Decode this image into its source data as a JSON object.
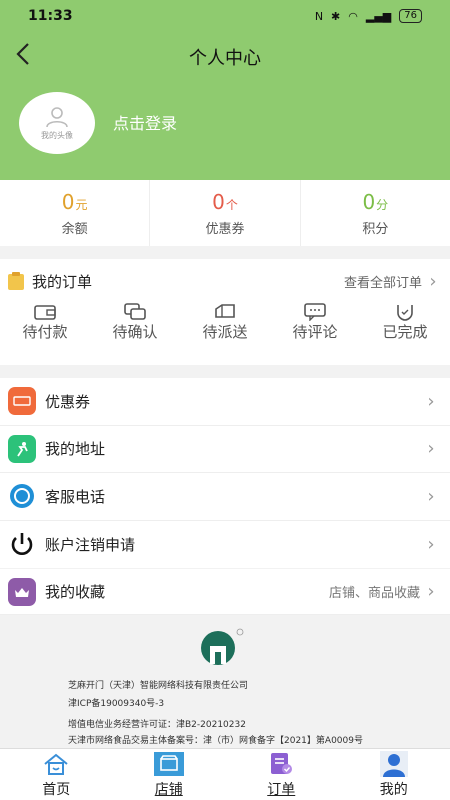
{
  "status_bar": {
    "time": "11:33",
    "battery": "76"
  },
  "header": {
    "title": "个人中心",
    "avatar_caption": "我的头像",
    "login_label": "点击登录"
  },
  "stats": [
    {
      "value": "0",
      "unit": "元",
      "label": "余额"
    },
    {
      "value": "0",
      "unit": "个",
      "label": "优惠券"
    },
    {
      "value": "0",
      "unit": "分",
      "label": "积分"
    }
  ],
  "orders": {
    "title": "我的订单",
    "view_all": "查看全部订单",
    "steps": [
      "待付款",
      "待确认",
      "待派送",
      "待评论",
      "已完成"
    ]
  },
  "menu": [
    {
      "label": "优惠券",
      "icon": "coupon-icon",
      "color": "#f06a3b"
    },
    {
      "label": "我的地址",
      "icon": "address-icon",
      "color": "#2cc27a"
    },
    {
      "label": "客服电话",
      "icon": "phone-icon",
      "color": "#1f8fd6"
    },
    {
      "label": "账户注销申请",
      "icon": "power-icon",
      "color": "#111111"
    }
  ],
  "favorites": {
    "label": "我的收藏",
    "hint": "店铺、商品收藏",
    "color": "#8e5ba8"
  },
  "footer": {
    "company": "芝麻开门（天津）智能网络科技有限责任公司",
    "icp": "津ICP备19009340号-3",
    "license": "增值电信业务经营许可证：津B2-20210232",
    "food": "天津市网络食品交易主体备案号：津（市）网食备字【2021】第A0009号"
  },
  "tabbar": [
    {
      "label": "首页",
      "icon": "home-icon"
    },
    {
      "label": "店铺",
      "icon": "store-icon"
    },
    {
      "label": "订单",
      "icon": "order-icon"
    },
    {
      "label": "我的",
      "icon": "user-icon"
    }
  ],
  "colors": {
    "header": "#8fcb6f",
    "balance": "#e0a12c",
    "coupon": "#e45c4a",
    "points": "#7bbd46"
  }
}
